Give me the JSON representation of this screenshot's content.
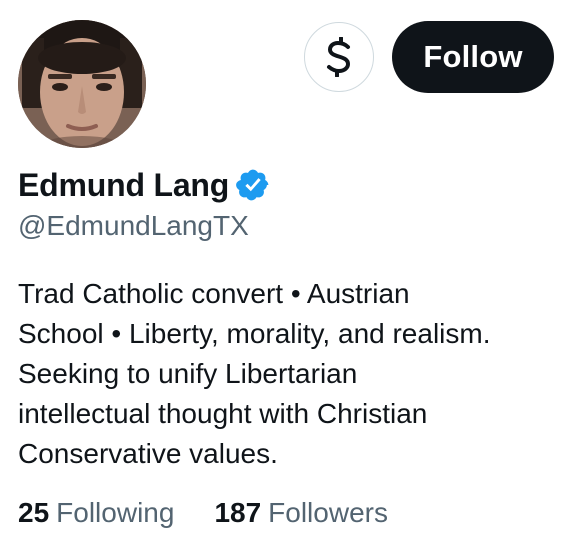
{
  "profile": {
    "display_name": "Edmund Lang",
    "handle": "@EdmundLangTX",
    "verified": true,
    "bio_lines": [
      "Trad Catholic convert • Austrian",
      "School • Liberty, morality, and realism.",
      "Seeking to unify Libertarian",
      "intellectual thought with Christian",
      "Conservative values."
    ]
  },
  "actions": {
    "tip_icon": "dollar-sign-icon",
    "follow_label": "Follow"
  },
  "stats": {
    "following_count": "25",
    "following_label": "Following",
    "followers_count": "187",
    "followers_label": "Followers"
  },
  "colors": {
    "text_primary": "#0f1419",
    "text_secondary": "#536471",
    "verified_blue": "#1d9bf0",
    "follow_bg": "#0f1419",
    "border": "#cfd9de"
  }
}
